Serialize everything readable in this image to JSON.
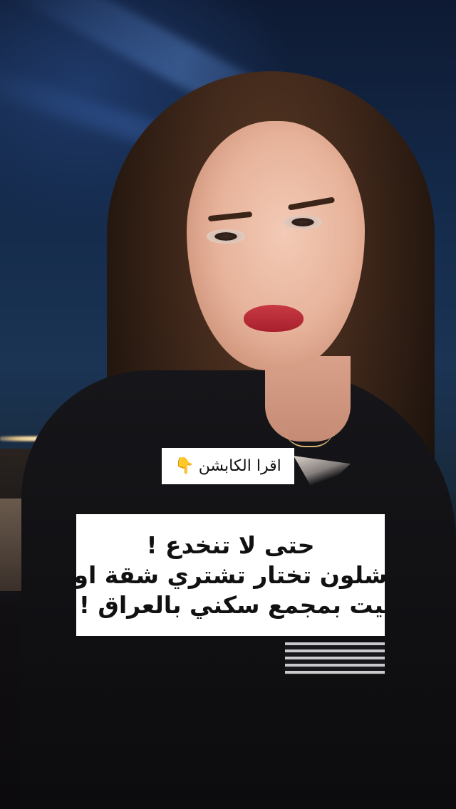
{
  "tag": {
    "text": "اقرا الكابشن",
    "emoji": "👇"
  },
  "caption": {
    "line1": "حتى لا تنخدع !",
    "line2": "شلون تختار تشتري شقة او",
    "line3": "بيت بمجمع سكني بالعراق !!"
  }
}
